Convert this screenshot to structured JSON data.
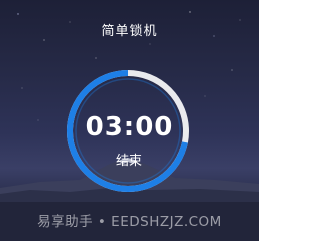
{
  "header": {
    "title": "简单锁机"
  },
  "timer": {
    "time": "03:00",
    "progress": 0.72
  },
  "actions": {
    "end_label": "结束"
  },
  "watermark": {
    "text": "易享助手 • EEDSHZJZ.COM"
  },
  "colors": {
    "ring_accent": "#1e7fe6",
    "ring_track": "#ffffff",
    "sky_top": "#1d2037",
    "sky_mid": "#2e3358"
  }
}
